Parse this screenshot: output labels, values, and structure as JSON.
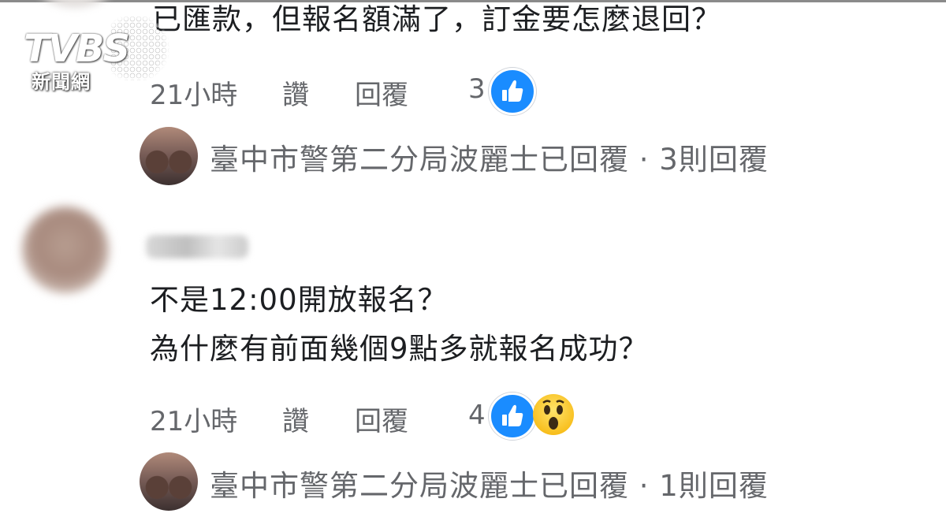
{
  "watermark": {
    "brand": "TVBS",
    "sub": "新聞網"
  },
  "comment1": {
    "text": "已匯款，但報名額滿了，訂金要怎麼退回？",
    "time": "21小時",
    "like_label": "讚",
    "reply_label": "回覆",
    "reactions_count": "3",
    "reactions": [
      "like-icon"
    ],
    "reply_summary": {
      "author": "臺中市警第二分局波麗士已回覆",
      "separator": " · ",
      "count": "3則回覆"
    }
  },
  "comment2": {
    "line1": "不是12:00開放報名？",
    "line2": "為什麼有前面幾個9點多就報名成功？",
    "time": "21小時",
    "like_label": "讚",
    "reply_label": "回覆",
    "reactions_count": "4",
    "reactions": [
      "like-icon",
      "wow-icon"
    ],
    "reply_summary": {
      "author": "臺中市警第二分局波麗士已回覆",
      "separator": " · ",
      "count": "1則回覆"
    }
  },
  "colors": {
    "like_blue": "#1a8cff",
    "meta_gray": "#65676b",
    "text": "#1c1e21"
  }
}
